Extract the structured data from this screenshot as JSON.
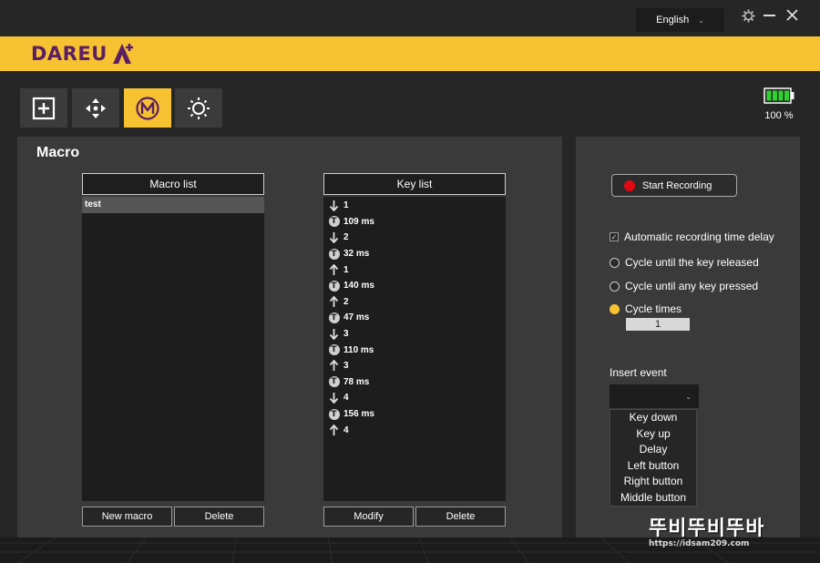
{
  "titlebar": {
    "language": "English",
    "settings_icon": "gear-icon",
    "minimize_icon": "minimize-icon",
    "close_icon": "close-icon"
  },
  "brand": {
    "logo_text": "DAREU",
    "logo_mark": "A",
    "accent_color": "#f6c232",
    "logo_color": "#5b1f63"
  },
  "mode_tabs": [
    {
      "icon": "plus-square-icon",
      "active": false
    },
    {
      "icon": "dpad-icon",
      "active": false
    },
    {
      "icon": "macro-m-icon",
      "active": true
    },
    {
      "icon": "light-sun-icon",
      "active": false
    }
  ],
  "battery": {
    "percent_label": "100 %",
    "level": 1.0
  },
  "macro": {
    "title": "Macro",
    "macro_list_header": "Macro list",
    "macros": [
      "test"
    ],
    "new_macro_label": "New macro",
    "delete_label": "Delete",
    "key_list_header": "Key list",
    "modify_label": "Modify",
    "key_delete_label": "Delete",
    "keys": [
      {
        "type": "down",
        "text": "1"
      },
      {
        "type": "delay",
        "text": "109 ms"
      },
      {
        "type": "down",
        "text": "2"
      },
      {
        "type": "delay",
        "text": "32 ms"
      },
      {
        "type": "up",
        "text": "1"
      },
      {
        "type": "delay",
        "text": "140 ms"
      },
      {
        "type": "up",
        "text": "2"
      },
      {
        "type": "delay",
        "text": "47 ms"
      },
      {
        "type": "down",
        "text": "3"
      },
      {
        "type": "delay",
        "text": "110 ms"
      },
      {
        "type": "up",
        "text": "3"
      },
      {
        "type": "delay",
        "text": "78 ms"
      },
      {
        "type": "down",
        "text": "4"
      },
      {
        "type": "delay",
        "text": "156 ms"
      },
      {
        "type": "up",
        "text": "4"
      }
    ]
  },
  "recording": {
    "start_label": "Start Recording",
    "auto_delay_label": "Automatic recording time delay",
    "auto_delay_checked": true,
    "cycle_options": [
      {
        "label": "Cycle until the key released",
        "selected": false
      },
      {
        "label": "Cycle until any key pressed",
        "selected": false
      },
      {
        "label": "Cycle times",
        "selected": true
      }
    ],
    "cycle_times_value": "1",
    "insert_event_label": "Insert event",
    "insert_event_options": [
      "Key down",
      "Key up",
      "Delay",
      "Left button",
      "Right button",
      "Middle button"
    ]
  },
  "watermark": {
    "big": "뚜비뚜비뚜바",
    "url": "https://idsam209.com"
  }
}
